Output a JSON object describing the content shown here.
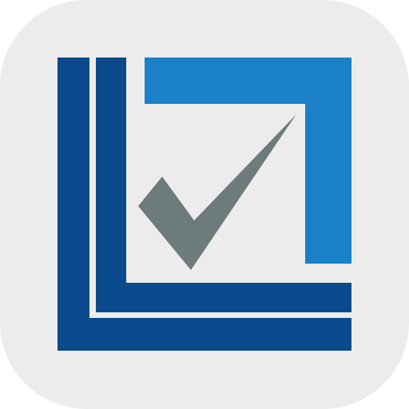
{
  "icon": {
    "name": "checklist-app-icon",
    "colors": {
      "tile_background": "#ececec",
      "outer_l": "#0a4a8c",
      "inner_l": "#0a4a8c",
      "frame": "#1a80c8",
      "checkmark": "#6e7b7c"
    }
  }
}
